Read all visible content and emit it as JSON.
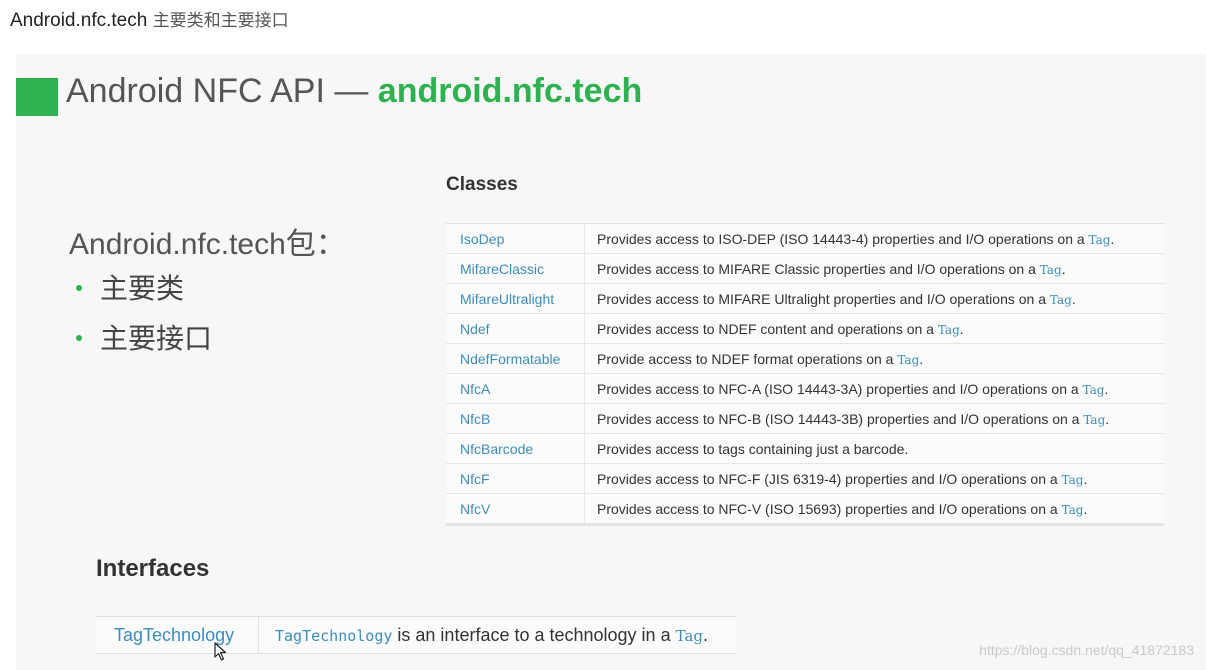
{
  "heading": {
    "title": "Android.nfc.tech",
    "subtitle": "主要类和主要接口"
  },
  "slide": {
    "title_prefix": "Android NFC API — ",
    "title_package": "android.nfc.tech",
    "left_heading": "Android.nfc.tech包：",
    "bullets": [
      "主要类",
      "主要接口"
    ],
    "classes_heading": "Classes",
    "classes": [
      {
        "name": "IsoDep",
        "desc": "Provides access to ISO-DEP (ISO 14443-4) properties and I/O operations on a ",
        "tag": "Tag",
        "end": "."
      },
      {
        "name": "MifareClassic",
        "desc": "Provides access to MIFARE Classic properties and I/O operations on a ",
        "tag": "Tag",
        "end": "."
      },
      {
        "name": "MifareUltralight",
        "desc": "Provides access to MIFARE Ultralight properties and I/O operations on a ",
        "tag": "Tag",
        "end": "."
      },
      {
        "name": "Ndef",
        "desc": "Provides access to NDEF content and operations on a ",
        "tag": "Tag",
        "end": "."
      },
      {
        "name": "NdefFormatable",
        "desc": "Provide access to NDEF format operations on a ",
        "tag": "Tag",
        "end": "."
      },
      {
        "name": "NfcA",
        "desc": "Provides access to NFC-A (ISO 14443-3A) properties and I/O operations on a ",
        "tag": "Tag",
        "end": "."
      },
      {
        "name": "NfcB",
        "desc": "Provides access to NFC-B (ISO 14443-3B) properties and I/O operations on a ",
        "tag": "Tag",
        "end": "."
      },
      {
        "name": "NfcBarcode",
        "desc": "Provides access to tags containing just a barcode.",
        "tag": "",
        "end": ""
      },
      {
        "name": "NfcF",
        "desc": "Provides access to NFC-F (JIS 6319-4) properties and I/O operations on a ",
        "tag": "Tag",
        "end": "."
      },
      {
        "name": "NfcV",
        "desc": "Provides access to NFC-V (ISO 15693) properties and I/O operations on a ",
        "tag": "Tag",
        "end": "."
      }
    ],
    "interfaces_heading": "Interfaces",
    "interfaces": [
      {
        "name": "TagTechnology",
        "code": "TagTechnology",
        "desc": " is an interface to a technology in a ",
        "tag": "Tag",
        "end": "."
      }
    ]
  },
  "watermark": "https://blog.csdn.net/qq_41872183",
  "colors": {
    "accent": "#2db24f",
    "link": "#3b8dbd"
  },
  "icons": {
    "cursor": "mouse-pointer-icon"
  }
}
